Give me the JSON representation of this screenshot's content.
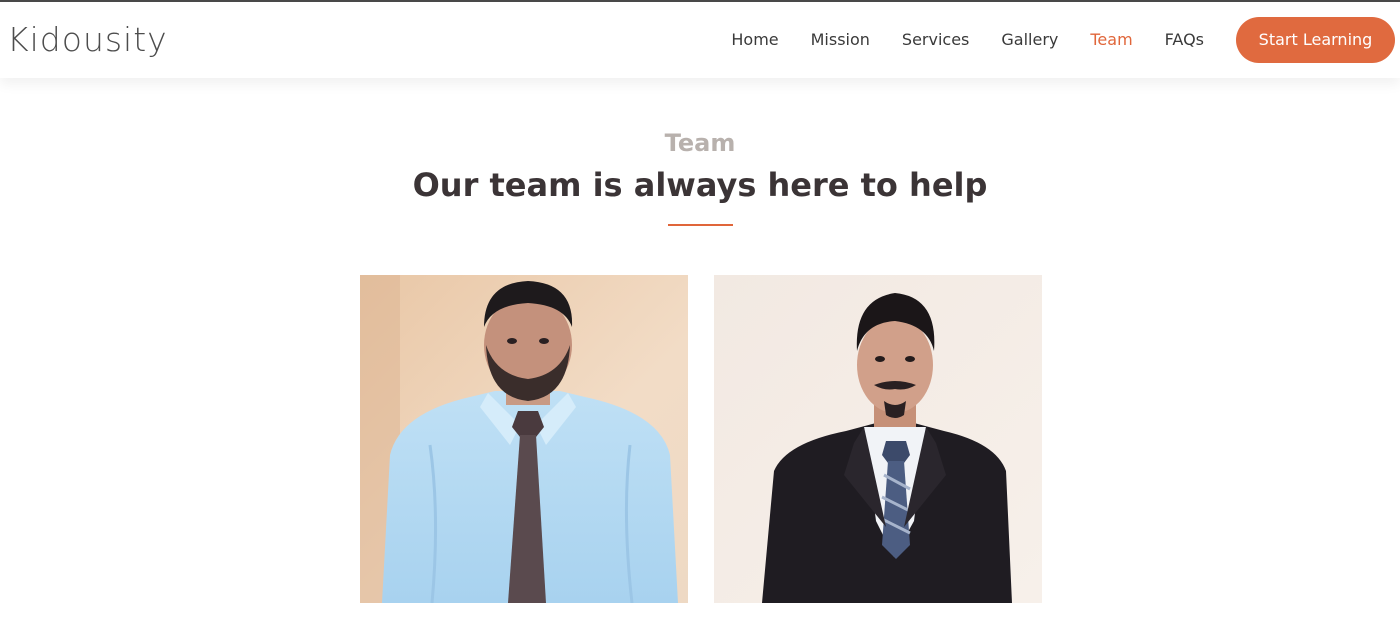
{
  "header": {
    "logo": "Kidousity",
    "nav": [
      {
        "label": "Home"
      },
      {
        "label": "Mission"
      },
      {
        "label": "Services"
      },
      {
        "label": "Gallery"
      },
      {
        "label": "Team",
        "active": true
      },
      {
        "label": "FAQs"
      }
    ],
    "cta_label": "Start Learning"
  },
  "team_section": {
    "label": "Team",
    "title": "Our team is always here to help",
    "members": [
      {
        "photo": "team-member-photo-blue-shirt"
      },
      {
        "photo": "team-member-photo-dark-suit"
      }
    ]
  },
  "colors": {
    "accent": "#e0663a",
    "button": "#e06a3f",
    "heading": "#3b3436",
    "label": "#b8b1ad"
  }
}
